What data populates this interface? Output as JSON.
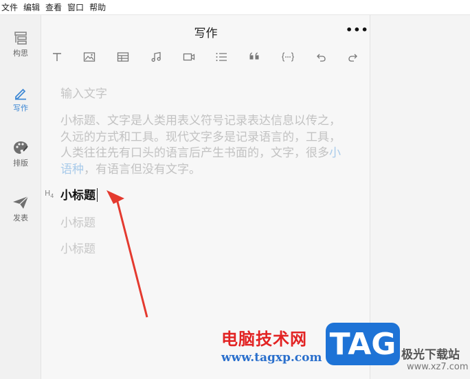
{
  "menu": [
    "文件",
    "编辑",
    "查看",
    "窗口",
    "帮助"
  ],
  "sidebar": {
    "items": [
      {
        "label": "构思",
        "icon": "outline-icon"
      },
      {
        "label": "写作",
        "icon": "pen-icon",
        "active": true
      },
      {
        "label": "排版",
        "icon": "palette-icon"
      },
      {
        "label": "发表",
        "icon": "paper-plane-icon"
      }
    ]
  },
  "editor": {
    "title": "写作",
    "more": "•••",
    "placeholder": "输入文字",
    "paragraph_before": "小标题、文字是人类用表义符号记录表达信息以传之，久远的方式和工具。现代文字多是记录语言的，工具，人类往往先有口头的语言后产生书面的，文字，很多",
    "paragraph_link": "小语种",
    "paragraph_after": "，有语言但没有文字。",
    "heading_marker": "H",
    "heading_level": "4",
    "heading": "小标题",
    "subheadings": [
      "小标题",
      "小标题"
    ]
  },
  "toolbar": [
    "text-icon",
    "image-icon",
    "table-icon",
    "music-icon",
    "video-icon",
    "list-icon",
    "quote-icon",
    "code-icon",
    "undo-icon",
    "redo-icon"
  ],
  "watermark": {
    "cn": "电脑技术网",
    "url": "www.tagxp.com",
    "tag": "TAG",
    "site": "极光下载站",
    "site2": "www.xz7.com"
  },
  "colors": {
    "accent": "#3a86d4",
    "arrow": "#e43a2f"
  }
}
